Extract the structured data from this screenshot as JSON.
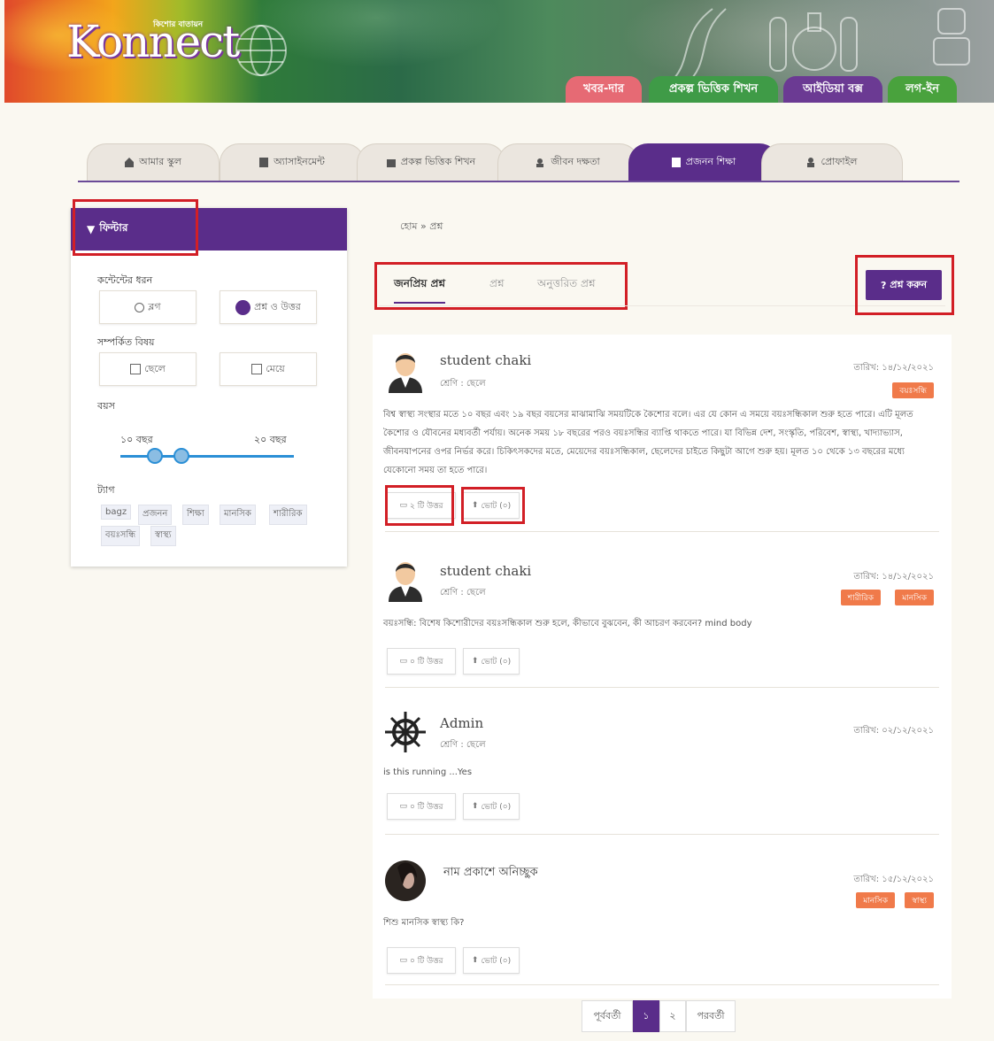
{
  "banner": {
    "tagline": "কিশোর বাতায়ন",
    "logo": "Konnect",
    "nav": [
      "খবর-দার",
      "প্রকল্প ভিত্তিক শিখন",
      "আইডিয়া বক্স",
      "লগ-ইন"
    ],
    "nav_colors": [
      "#e66a74",
      "#3f9b47",
      "#6b3a93",
      "#49a23d"
    ]
  },
  "tabs": [
    {
      "label": "আমার স্কুল",
      "icon": "school-icon"
    },
    {
      "label": "অ্যাসাইনমেন্ট",
      "icon": "assignment-icon"
    },
    {
      "label": "প্রকল্প ভিত্তিক শিখন",
      "icon": "project-icon"
    },
    {
      "label": "জীবন দক্ষতা",
      "icon": "life-skill-icon"
    },
    {
      "label": "প্রজনন শিক্ষা",
      "icon": "book-icon",
      "active": true
    },
    {
      "label": "প্রোফাইল",
      "icon": "profile-icon"
    }
  ],
  "sidebar": {
    "title": "ফিল্টার",
    "content_type_label": "কন্টেন্টের ধরন",
    "content_types": [
      "ব্লগ",
      "প্রশ্ন ও উত্তর"
    ],
    "related_label": "সম্পর্কিত বিষয়",
    "related": [
      "ছেলে",
      "মেয়ে"
    ],
    "age_label": "বয়স",
    "age_min": "১০ বছর",
    "age_max": "২০ বছর",
    "tags_label": "ট্যাগ",
    "tags": [
      "bagz",
      "প্রজনন",
      "শিক্ষা",
      "মানসিক",
      "শারীরিক",
      "বয়ঃসন্ধি",
      "স্বাস্থ্য"
    ]
  },
  "main": {
    "breadcrumb": "হোম » প্রশ্ন",
    "tabs": [
      "জনপ্রিয় প্রশ্ন",
      "প্রশ্ন",
      "অনুত্তরিত প্রশ্ন"
    ],
    "ask_button": "প্রশ্ন করুন",
    "date_prefix": "তারিখ:",
    "posts": [
      {
        "name": "student chaki",
        "class": "শ্রেণি : ছেলে",
        "date": "১৪/১২/২০২১",
        "badges": [
          "বয়ঃসন্ধি"
        ],
        "body": "বিশ্ব স্বাস্থ্য সংস্থার মতে ১০ বছর এবং ১৯ বছর বয়সের মাঝামাঝি সময়টিকে কৈশোর বলে। এর যে কোন এ সময়ে বয়ঃসন্ধিকাল শুরু হতে পারে। এটি মূলত কৈশোর ও যৌবনের মধ্যবর্তী পর্যায়। অনেক সময় ১৮ বছরের পরও বয়ঃসন্ধির ব্যাপ্তি থাকতে পারে। যা বিভিন্ন দেশ, সংস্কৃতি, পরিবেশ, স্বাস্থ্য, খাদ্যাভ্যাস, জীবনযাপনের ওপর নির্ভর করে। চিকিৎসকদের মতে, মেয়েদের বয়ঃসন্ধিকাল, ছেলেদের চাইতে কিছুটা আগে শুরু হয়। মূলত ১০ থেকে ১৩ বছরের মধ্যে যেকোনো সময় তা হতে পারে।",
        "answers": "২ টি উত্তর",
        "votes": "ভোট (০)",
        "avatar": "male-avatar"
      },
      {
        "name": "student chaki",
        "class": "শ্রেণি : ছেলে",
        "date": "১৪/১২/২০২১",
        "badges": [
          "শারীরিক",
          "মানসিক"
        ],
        "body": "বয়ঃসন্ধি: বিশেষ কিশোরীদের বয়ঃসন্ধিকাল শুরু হলে, কীভাবে বুঝবেন, কী আচরণ করবেন? mind body",
        "answers": "০ টি উত্তর",
        "votes": "ভোট (০)",
        "avatar": "male-avatar"
      },
      {
        "name": "Admin",
        "class": "শ্রেণি : ছেলে",
        "date": "০২/১২/২০২১",
        "badges": [],
        "body": "is this running ...Yes",
        "answers": "০ টি উত্তর",
        "votes": "ভোট (০)",
        "avatar": "helm-icon"
      },
      {
        "name": "নাম প্রকাশে অনিচ্ছুক",
        "class": "",
        "date": "১৫/১২/২০২১",
        "badges": [
          "মানসিক",
          "স্বাস্থ্য"
        ],
        "body": "শিশু মানসিক স্বাস্থ্য কি?",
        "answers": "০ টি উত্তর",
        "votes": "ভোট (০)",
        "avatar": "female-avatar"
      }
    ]
  },
  "pagination": {
    "prev": "পূর্ববর্তী",
    "pages": [
      "১",
      "২"
    ],
    "current": "১",
    "next": "পরবর্তী"
  }
}
